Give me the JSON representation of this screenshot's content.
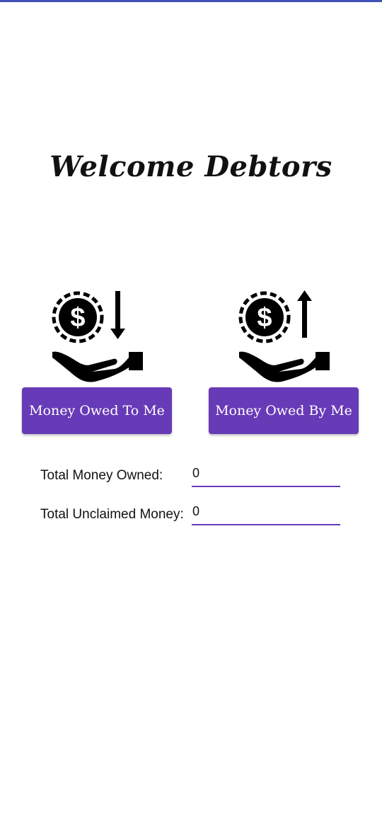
{
  "theme": {
    "accent": "#673ab7",
    "top_bar_color": "#3f51b5",
    "icon_color": "#000000"
  },
  "header": {
    "title": "Welcome Debtors"
  },
  "actions": {
    "left": {
      "icon": "hand-receiving-money-icon",
      "label": "Money Owed To Me"
    },
    "right": {
      "icon": "hand-giving-money-icon",
      "label": "Money Owed By Me"
    }
  },
  "summary": {
    "total_owned_label": "Total Money Owned:",
    "total_owned_value": "0",
    "total_unclaimed_label": "Total Unclaimed Money:",
    "total_unclaimed_value": "0"
  }
}
